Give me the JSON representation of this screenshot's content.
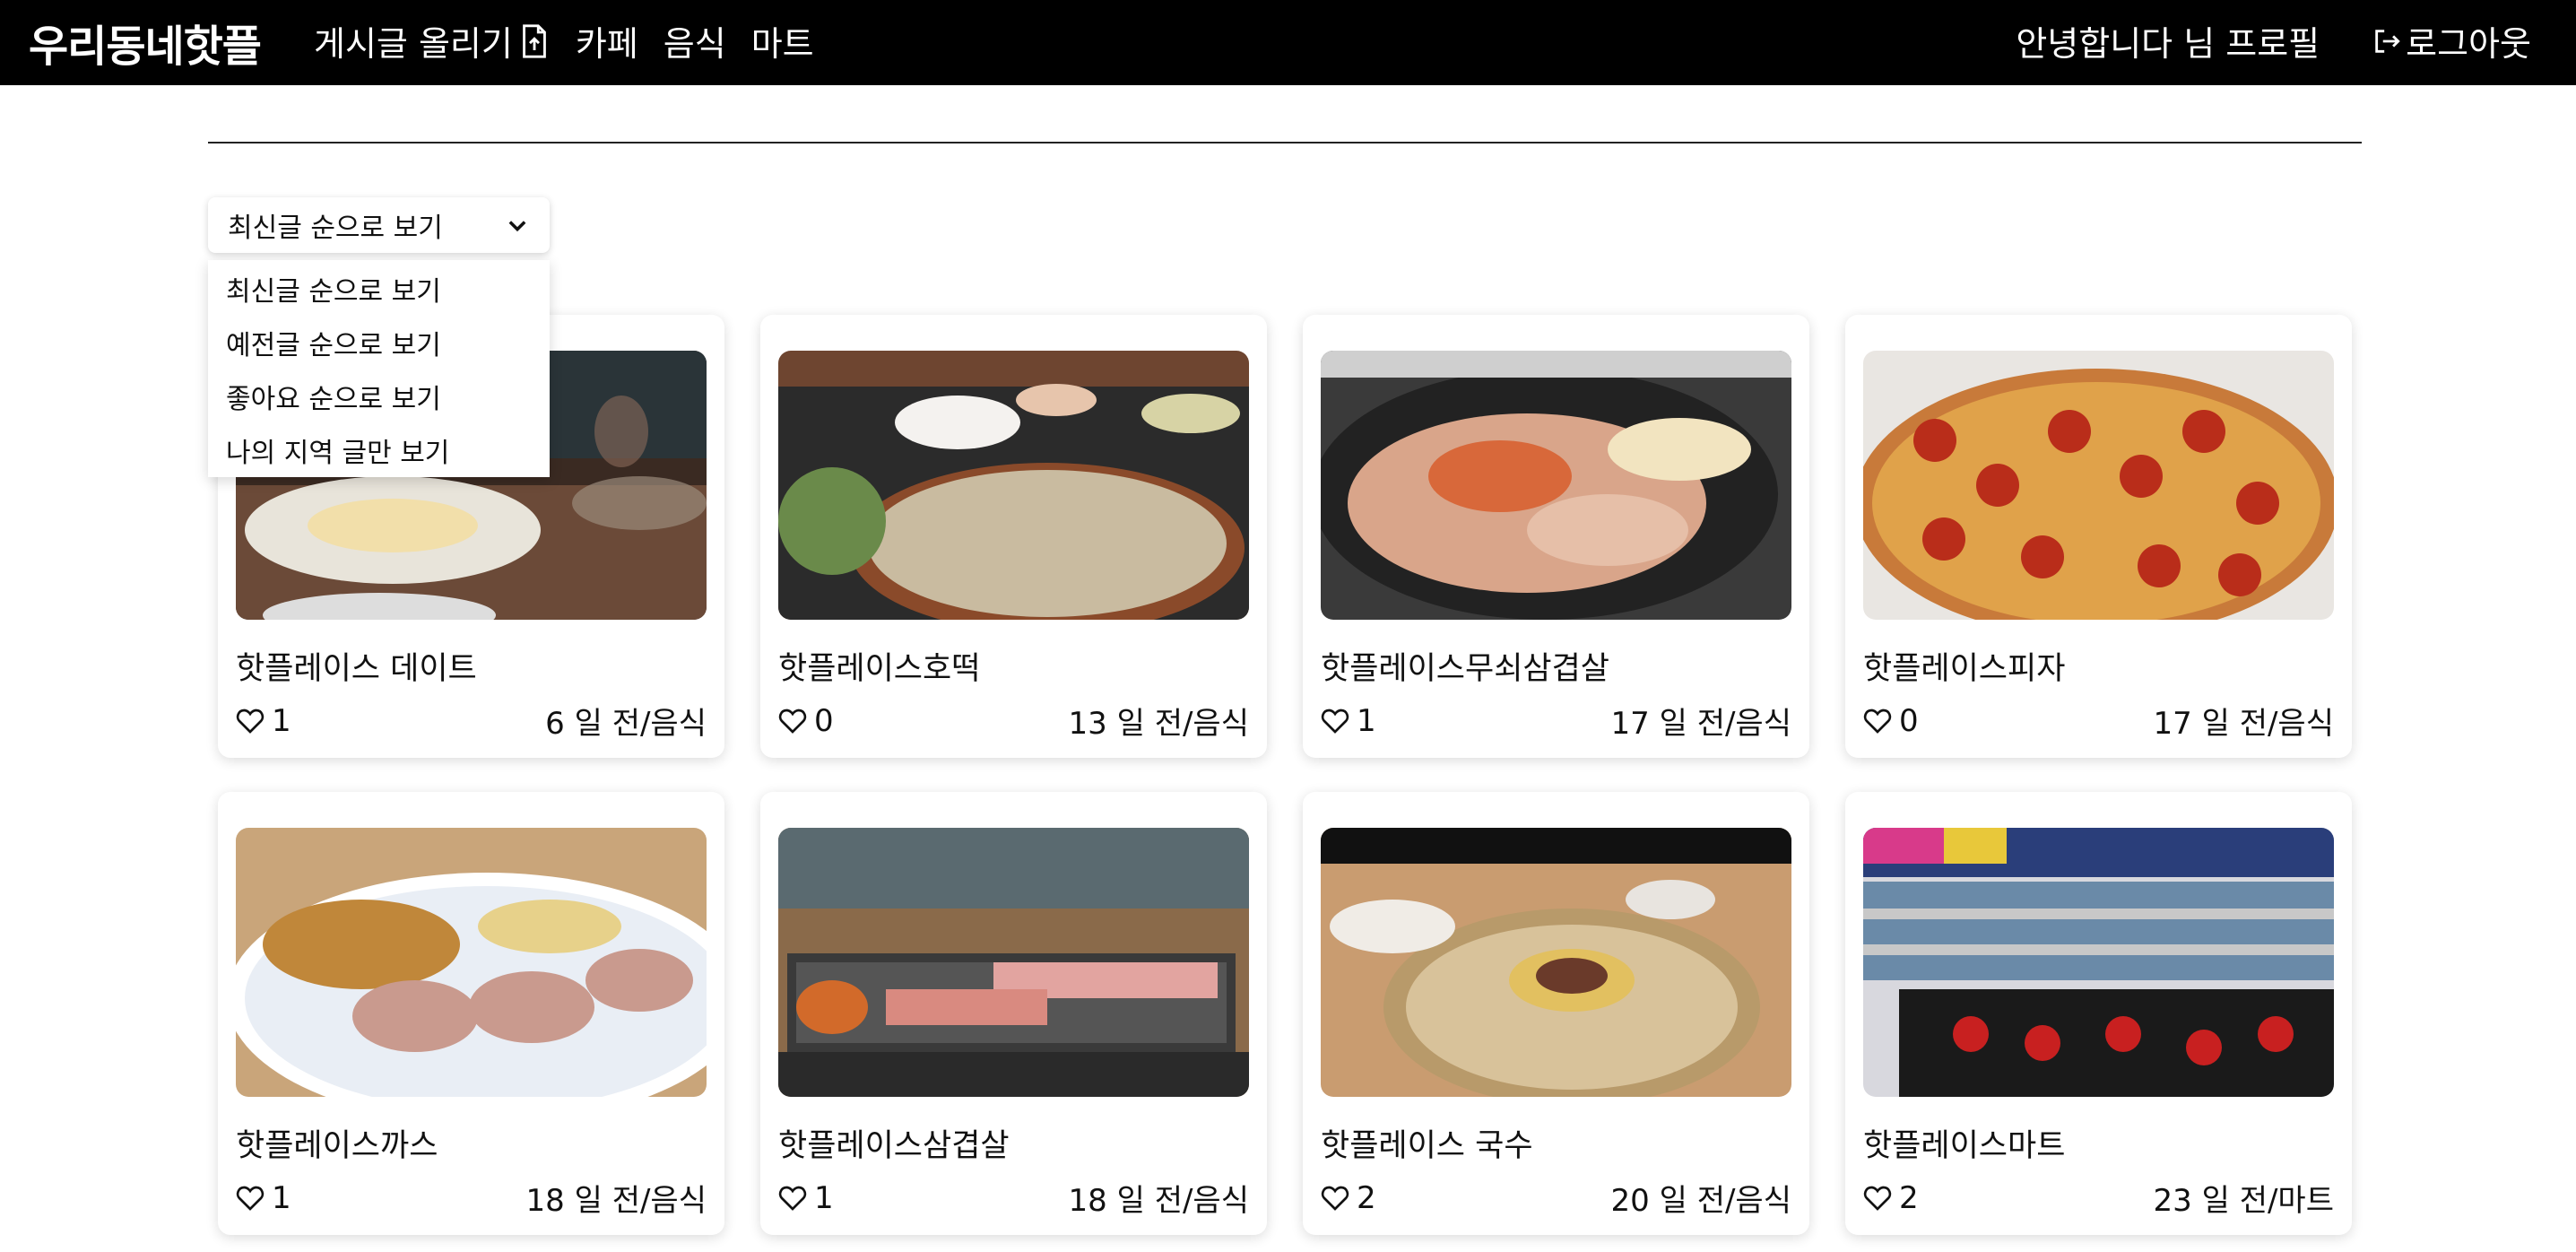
{
  "header": {
    "brand": "우리동네핫플",
    "nav": {
      "post": "게시글 올리기",
      "cafe": "카페",
      "food": "음식",
      "mart": "마트"
    },
    "greeting": "안녕합니다 님 프로필",
    "logout": "로그아웃"
  },
  "sort": {
    "selected": "최신글 순으로 보기",
    "options": [
      "최신글 순으로 보기",
      "예전글 순으로 보기",
      "좋아요 순으로 보기",
      "나의 지역 글만 보기"
    ]
  },
  "posts": [
    {
      "title": "핫플레이스 데이트",
      "likes": "1",
      "meta": "6 일 전/음식",
      "thumb": "dinner-plate-photo"
    },
    {
      "title": "핫플레이스호떡",
      "likes": "0",
      "meta": "13 일 전/음식",
      "thumb": "pancake-photo"
    },
    {
      "title": "핫플레이스무쇠삼겹살",
      "likes": "1",
      "meta": "17 일 전/음식",
      "thumb": "grill-pork-photo"
    },
    {
      "title": "핫플레이스피자",
      "likes": "0",
      "meta": "17 일 전/음식",
      "thumb": "pepperoni-pizza-photo"
    },
    {
      "title": "핫플레이스까스",
      "likes": "1",
      "meta": "18 일 전/음식",
      "thumb": "katsu-photo"
    },
    {
      "title": "핫플레이스삼겹살",
      "likes": "1",
      "meta": "18 일 전/음식",
      "thumb": "samgyeopsal-photo"
    },
    {
      "title": "핫플레이스 국수",
      "likes": "2",
      "meta": "20 일 전/음식",
      "thumb": "noodle-photo"
    },
    {
      "title": "핫플레이스마트",
      "likes": "2",
      "meta": "23 일 전/마트",
      "thumb": "liquor-store-photo"
    }
  ],
  "colors": {
    "header_bg": "#000000",
    "page_bg": "#ffffff",
    "text": "#111111"
  }
}
